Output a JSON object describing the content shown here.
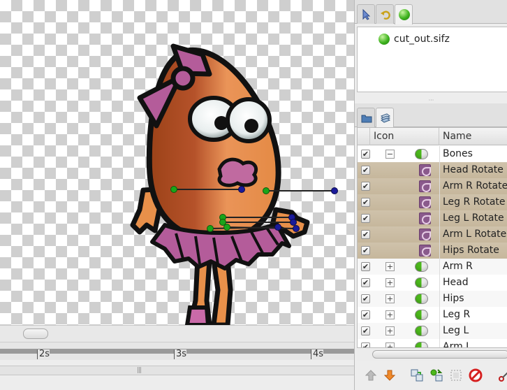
{
  "canvas_browser": {
    "file_name": "cut_out.sifz"
  },
  "timeline": {
    "labels": [
      "2s",
      "3s",
      "4s"
    ]
  },
  "layers_panel": {
    "columns": {
      "icon": "Icon",
      "name": "Name"
    },
    "rows": [
      {
        "name": "Bones",
        "kind": "skeleton-group",
        "checked": true,
        "expander": "−"
      },
      {
        "name": "Head Rotate",
        "kind": "bone",
        "checked": true
      },
      {
        "name": "Arm R Rotate",
        "kind": "bone",
        "checked": true
      },
      {
        "name": "Leg R Rotate",
        "kind": "bone",
        "checked": true
      },
      {
        "name": "Leg L Rotate",
        "kind": "bone",
        "checked": true
      },
      {
        "name": "Arm L Rotate",
        "kind": "bone",
        "checked": true
      },
      {
        "name": "Hips Rotate",
        "kind": "bone",
        "checked": true
      },
      {
        "name": "Arm R",
        "kind": "group",
        "checked": true,
        "expander": "+"
      },
      {
        "name": "Head",
        "kind": "group",
        "checked": true,
        "expander": "+"
      },
      {
        "name": "Hips",
        "kind": "group",
        "checked": true,
        "expander": "+"
      },
      {
        "name": "Leg R",
        "kind": "group",
        "checked": true,
        "expander": "+"
      },
      {
        "name": "Leg L",
        "kind": "group",
        "checked": true,
        "expander": "+"
      },
      {
        "name": "Arm L",
        "kind": "group",
        "checked": true,
        "expander": "+"
      }
    ]
  },
  "icons": {
    "top_tabs": [
      "pointer-icon",
      "undo-history-icon",
      "canvas-browser-icon"
    ],
    "bottom_tabs": [
      "folder-icon",
      "layers-icon"
    ],
    "toolbar": [
      "raise-layer-icon",
      "lower-layer-icon",
      "duplicate-layer-icon",
      "encapsulate-icon",
      "select-all-icon",
      "delete-layer-icon",
      "cut-icon"
    ]
  },
  "colors": {
    "skeleton_row": "#c9bba0",
    "bone_handle_green": "#1aa51a",
    "bone_handle_blue": "#1a1a9a",
    "character_body": "#e8904a",
    "skirt": "#b45c9a"
  }
}
